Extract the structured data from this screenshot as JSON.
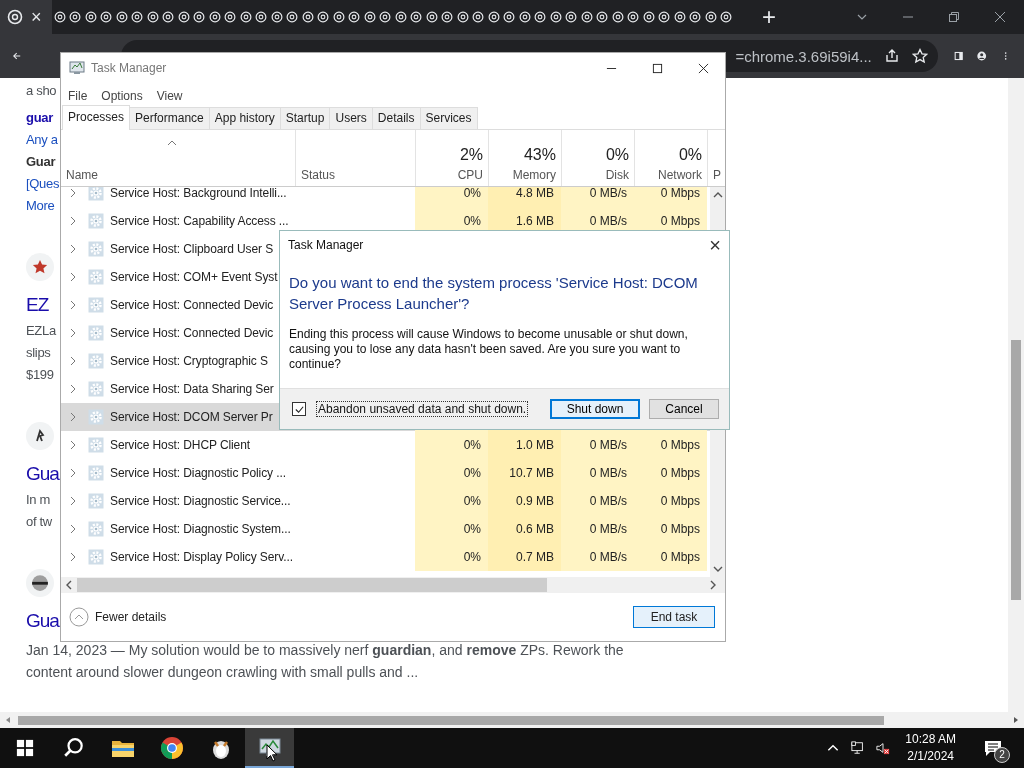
{
  "browser": {
    "tabs": [
      {
        "selected": true,
        "close": "×"
      },
      {
        "selected": false
      },
      {
        "selected": false
      },
      {
        "selected": false
      },
      {
        "selected": false
      },
      {
        "selected": false
      },
      {
        "selected": false
      },
      {
        "selected": false
      },
      {
        "selected": false
      },
      {
        "selected": false
      },
      {
        "selected": false
      },
      {
        "selected": false
      },
      {
        "selected": false
      },
      {
        "selected": false
      },
      {
        "selected": false
      },
      {
        "selected": false
      },
      {
        "selected": false
      },
      {
        "selected": false
      },
      {
        "selected": false
      },
      {
        "selected": false
      },
      {
        "selected": false
      },
      {
        "selected": false
      },
      {
        "selected": false
      },
      {
        "selected": false
      },
      {
        "selected": false
      },
      {
        "selected": false
      },
      {
        "selected": false
      },
      {
        "selected": false
      },
      {
        "selected": false
      },
      {
        "selected": false
      },
      {
        "selected": false
      },
      {
        "selected": false
      },
      {
        "selected": false
      },
      {
        "selected": false
      },
      {
        "selected": false
      },
      {
        "selected": false
      },
      {
        "selected": false
      },
      {
        "selected": false
      },
      {
        "selected": false
      },
      {
        "selected": false
      },
      {
        "selected": false
      },
      {
        "selected": false
      },
      {
        "selected": false
      },
      {
        "selected": false
      },
      {
        "selected": false
      }
    ],
    "new_tab": "+",
    "address": "=chrome.3.69i59i4..."
  },
  "page": {
    "blocks": [
      {
        "kind": "text",
        "text": "a sho"
      },
      {
        "kind": "bold",
        "text": "guar"
      },
      {
        "kind": "link",
        "text": "Any a"
      },
      {
        "kind": "boldgray",
        "text": "Guar"
      },
      {
        "kind": "link",
        "text": "[Ques"
      },
      {
        "kind": "link",
        "text": "More"
      },
      {
        "kind": "star-icon"
      },
      {
        "kind": "title",
        "text": "EZ"
      },
      {
        "kind": "text",
        "text": "EZLa"
      },
      {
        "kind": "text",
        "text": "slips"
      },
      {
        "kind": "text",
        "text": "$199"
      },
      {
        "kind": "logo-icon"
      },
      {
        "kind": "title",
        "text": "Gua"
      },
      {
        "kind": "text",
        "text": "In m"
      },
      {
        "kind": "text",
        "text": "of tw"
      },
      {
        "kind": "disc-icon"
      },
      {
        "kind": "title",
        "text": "Gua"
      },
      {
        "kind": "snippet",
        "text": "Jan 14, 2023 — My solution would be to massively nerf **guardian**, and **remove** ZPs. Rework the content around slower dungeon crawling with small pulls and ..."
      }
    ]
  },
  "task_manager": {
    "title": "Task Manager",
    "menu": [
      "File",
      "Options",
      "View"
    ],
    "tabs": [
      {
        "label": "Processes",
        "selected": true
      },
      {
        "label": "Performance",
        "selected": false
      },
      {
        "label": "App history",
        "selected": false
      },
      {
        "label": "Startup",
        "selected": false
      },
      {
        "label": "Users",
        "selected": false
      },
      {
        "label": "Details",
        "selected": false
      },
      {
        "label": "Services",
        "selected": false
      }
    ],
    "columns": [
      {
        "label": "Name"
      },
      {
        "label": "Status"
      },
      {
        "label": "CPU",
        "usage": "2%"
      },
      {
        "label": "Memory",
        "usage": "43%"
      },
      {
        "label": "Disk",
        "usage": "0%"
      },
      {
        "label": "Network",
        "usage": "0%"
      },
      {
        "label": "P"
      }
    ],
    "rows": [
      {
        "name": "Service Host: Background Intelli...",
        "cpu": "0%",
        "memory": "4.8 MB",
        "disk": "0 MB/s",
        "network": "0 Mbps",
        "selected": false
      },
      {
        "name": "Service Host: Capability Access ...",
        "cpu": "0%",
        "memory": "1.6 MB",
        "disk": "0 MB/s",
        "network": "0 Mbps",
        "selected": false
      },
      {
        "name": "Service Host: Clipboard User S",
        "selected": false
      },
      {
        "name": "Service Host: COM+ Event Syst",
        "selected": false
      },
      {
        "name": "Service Host: Connected Devic",
        "selected": false
      },
      {
        "name": "Service Host: Connected Devic",
        "selected": false
      },
      {
        "name": "Service Host: Cryptographic S",
        "selected": false
      },
      {
        "name": "Service Host: Data Sharing Ser",
        "selected": false
      },
      {
        "name": "Service Host: DCOM Server Pr",
        "selected": true
      },
      {
        "name": "Service Host: DHCP Client",
        "cpu": "0%",
        "memory": "1.0 MB",
        "disk": "0 MB/s",
        "network": "0 Mbps",
        "selected": false
      },
      {
        "name": "Service Host: Diagnostic Policy ...",
        "cpu": "0%",
        "memory": "10.7 MB",
        "disk": "0 MB/s",
        "network": "0 Mbps",
        "selected": false
      },
      {
        "name": "Service Host: Diagnostic Service...",
        "cpu": "0%",
        "memory": "0.9 MB",
        "disk": "0 MB/s",
        "network": "0 Mbps",
        "selected": false
      },
      {
        "name": "Service Host: Diagnostic System...",
        "cpu": "0%",
        "memory": "0.6 MB",
        "disk": "0 MB/s",
        "network": "0 Mbps",
        "selected": false
      },
      {
        "name": "Service Host: Display Policy Serv...",
        "cpu": "0%",
        "memory": "0.7 MB",
        "disk": "0 MB/s",
        "network": "0 Mbps",
        "selected": false
      }
    ],
    "fewer_details": "Fewer details",
    "end_task": "End task"
  },
  "dialog": {
    "title": "Task Manager",
    "close": "×",
    "heading": "Do you want to end the system process 'Service Host: DCOM Server Process Launcher'?",
    "message": "Ending this process will cause Windows to become unusable or shut down, causing you to lose any data hasn't been saved. Are you sure you want to continue?",
    "checkbox": {
      "label": "Abandon unsaved data and shut down.",
      "checked": true
    },
    "buttons": [
      {
        "label": "Shut down",
        "default": true
      },
      {
        "label": "Cancel",
        "default": false
      }
    ]
  },
  "taskbar": {
    "apps": [
      {
        "kind": "start",
        "active": false
      },
      {
        "kind": "search",
        "active": false
      },
      {
        "kind": "folder",
        "active": false
      },
      {
        "kind": "chrome",
        "active": false
      },
      {
        "kind": "penguin",
        "active": false
      },
      {
        "kind": "taskmgr",
        "active": true
      }
    ],
    "time": "10:28 AM",
    "date": "2/1/2024",
    "notifications": "2"
  }
}
